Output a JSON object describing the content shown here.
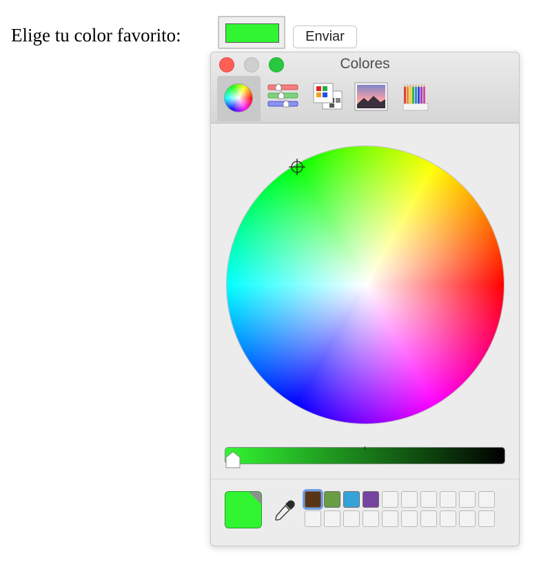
{
  "page": {
    "prompt_label": "Elige tu color favorito:",
    "submit_label": "Enviar",
    "selected_color": "#31f531"
  },
  "color_panel": {
    "title": "Colores",
    "window_controls": [
      "close-icon",
      "minimize-icon",
      "zoom-icon"
    ],
    "tabs": [
      {
        "name": "color-wheel",
        "icon": "color-wheel-icon",
        "selected": true
      },
      {
        "name": "color-sliders",
        "icon": "sliders-icon",
        "selected": false
      },
      {
        "name": "color-palettes",
        "icon": "palette-icon",
        "selected": false
      },
      {
        "name": "image-palettes",
        "icon": "image-palette-icon",
        "selected": false
      },
      {
        "name": "pencils",
        "icon": "pencils-icon",
        "selected": false
      }
    ],
    "brightness_level": 1.0,
    "current_color": "#31f531",
    "swatches": [
      {
        "color": "#5a3417",
        "selected": true
      },
      {
        "color": "#6a9c43"
      },
      {
        "color": "#34a4d8"
      },
      {
        "color": "#7544a1"
      },
      {
        "color": ""
      },
      {
        "color": ""
      },
      {
        "color": ""
      },
      {
        "color": ""
      },
      {
        "color": ""
      },
      {
        "color": ""
      },
      {
        "color": ""
      },
      {
        "color": ""
      },
      {
        "color": ""
      },
      {
        "color": ""
      },
      {
        "color": ""
      },
      {
        "color": ""
      },
      {
        "color": ""
      },
      {
        "color": ""
      },
      {
        "color": ""
      },
      {
        "color": ""
      }
    ]
  }
}
